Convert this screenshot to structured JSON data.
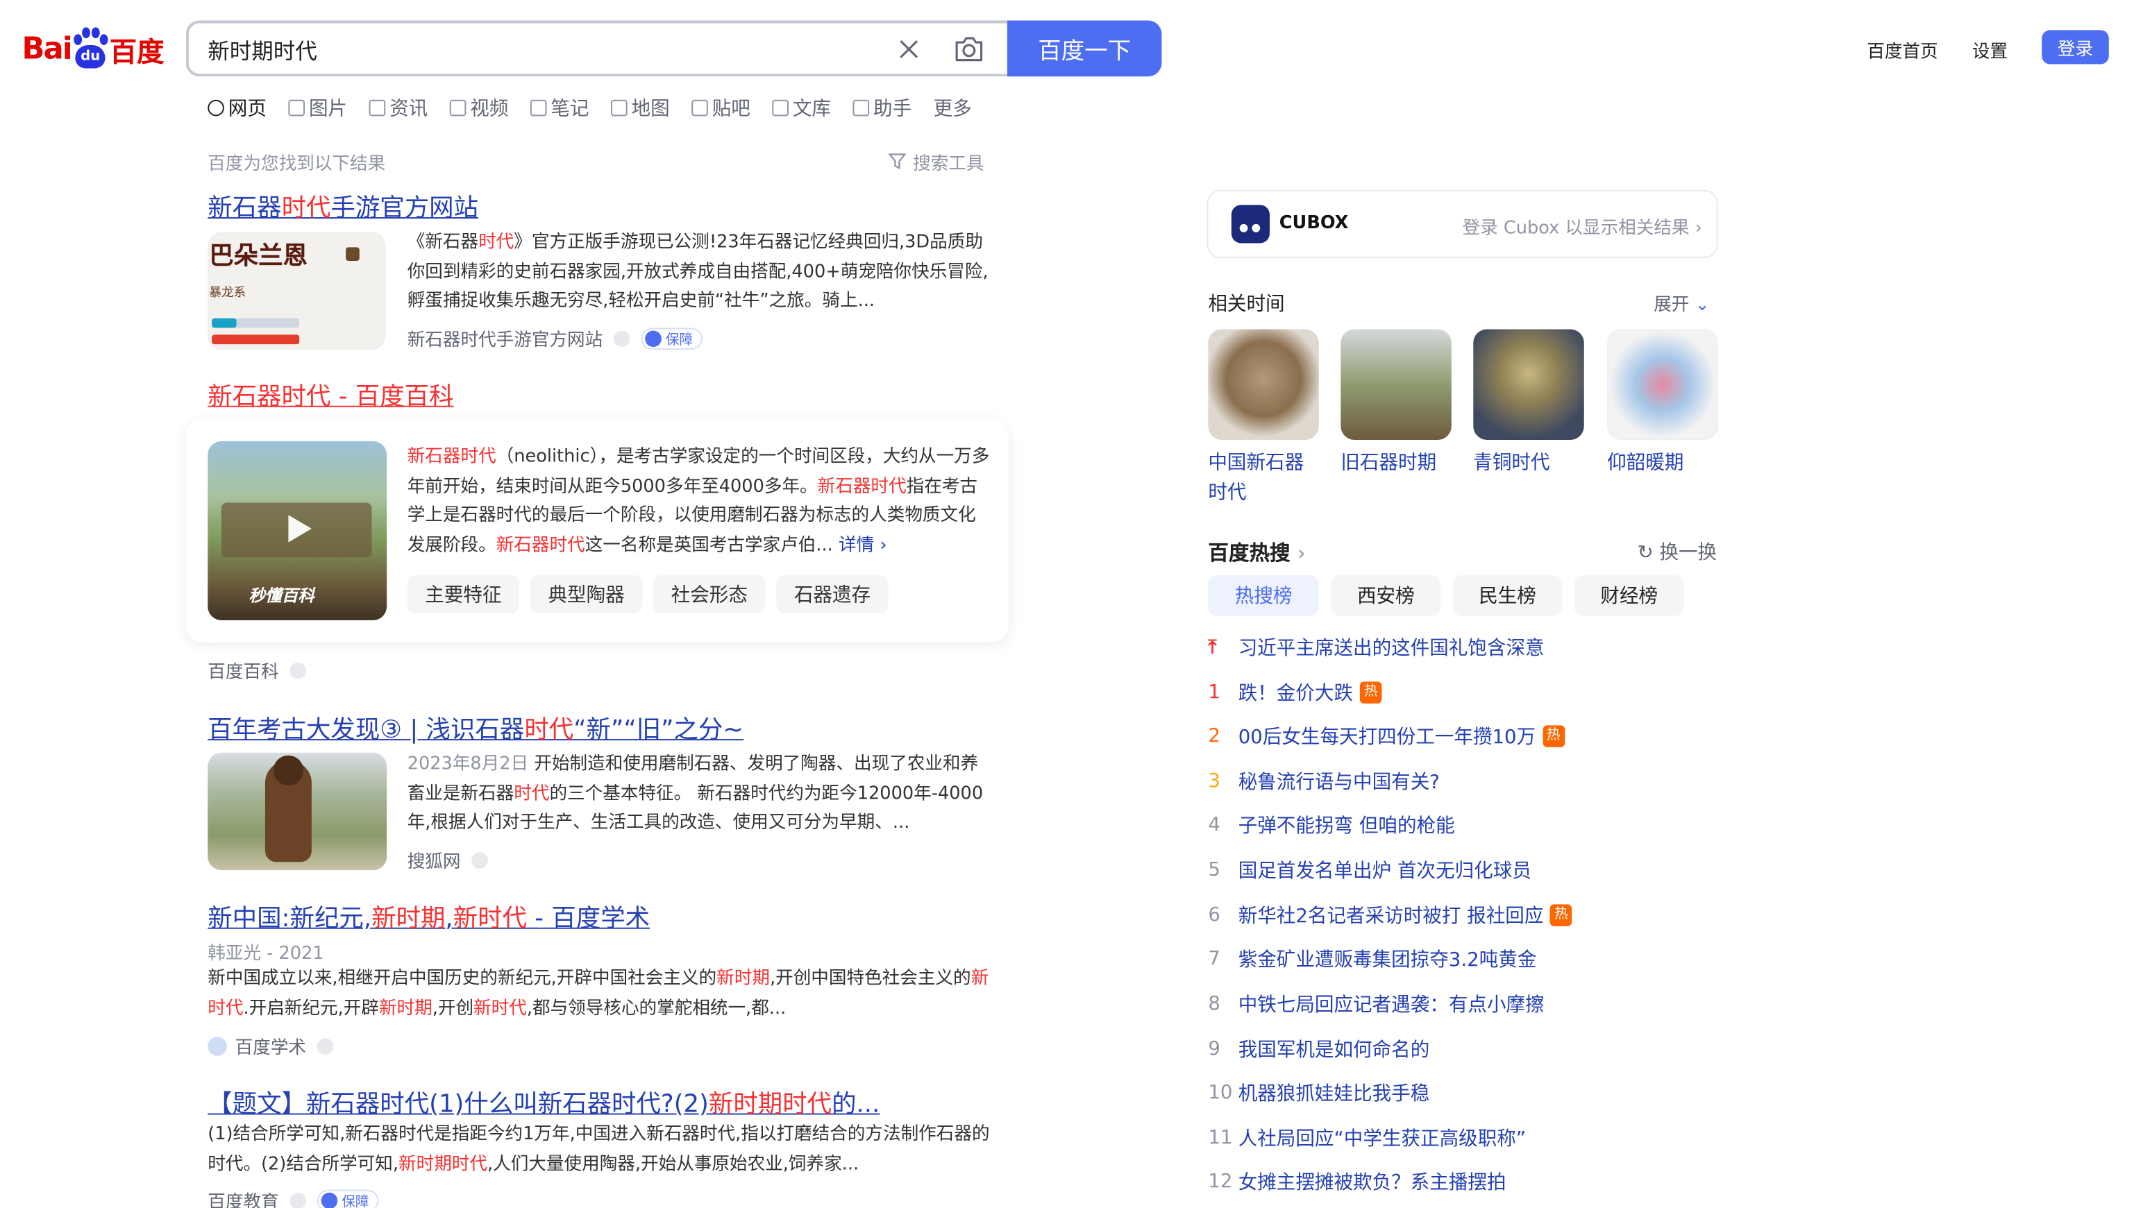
{
  "logo": {
    "left": "Bai",
    "paw": "du",
    "right": "百度"
  },
  "search": {
    "value": "新时期时代",
    "button": "百度一下"
  },
  "header_links": {
    "home": "百度首页",
    "settings": "设置",
    "login": "登录"
  },
  "tabs": [
    {
      "label": "网页",
      "active": true
    },
    {
      "label": "图片"
    },
    {
      "label": "资讯"
    },
    {
      "label": "视频"
    },
    {
      "label": "笔记"
    },
    {
      "label": "地图"
    },
    {
      "label": "贴吧"
    },
    {
      "label": "文库"
    },
    {
      "label": "助手"
    },
    {
      "label": "更多"
    }
  ],
  "results_info": "百度为您找到以下结果",
  "search_tools": "搜索工具",
  "results": [
    {
      "title_parts": [
        "新石器",
        "时代",
        "手游官方网站"
      ],
      "thumb_title": "巴朵兰恩",
      "thumb_sub": "暴龙系",
      "snippet_parts": [
        "《新石器",
        "时代",
        "》官方正版手游现已公测!23年石器记忆经典回归,3D品质助你回到精彩的史前石器家园,开放式养成自由搭配,400+萌宠陪你快乐冒险,孵蛋捕捉收集乐趣无穷尽,轻松开启史前“社牛”之旅。骑上..."
      ],
      "source": "新石器时代手游官方网站",
      "badge": "保障"
    },
    {
      "title": "新石器时代 - 百度百科",
      "thumb_caption": "秒懂百科",
      "snippet_parts": [
        "新石器时代",
        "（neolithic），是考古学家设定的一个时间区段，大约从一万多年前开始，结束时间从距今5000多年至4000多年。",
        "新石器时代",
        "指在考古学上是石器时代的最后一个阶段，以使用磨制石器为标志的人类物质文化发展阶段。",
        "新石器时代",
        "这一名称是英国考古学家卢伯..."
      ],
      "more": "详情",
      "chips": [
        "主要特征",
        "典型陶器",
        "社会形态",
        "石器遗存"
      ],
      "source": "百度百科"
    },
    {
      "title_parts": [
        "百年考古大发现③ | 浅识石器",
        "时代",
        "“新”“旧”之分~"
      ],
      "date": "2023年8月2日",
      "snippet_parts": [
        "开始制造和使用磨制石器、发明了陶器、出现了农业和养畜业是新石器",
        "时代",
        "的三个基本特征。 新石器时代约为距今12000年-4000年,根据人们对于生产、生活工具的改造、使用又可分为早期、..."
      ],
      "source": "搜狐网"
    },
    {
      "title_parts": [
        "新中国:新纪元,",
        "新时期",
        ",",
        "新时代",
        " - 百度学术"
      ],
      "author": "韩亚光 - 2021",
      "snippet_parts": [
        "新中国成立以来,相继开启中国历史的新纪元,开辟中国社会主义的",
        "新时期",
        ",开创中国特色社会主义的",
        "新时代",
        ".开启新纪元,开辟",
        "新时期",
        ",开创",
        "新时代",
        ",都与领导核心的掌舵相统一,都..."
      ],
      "source": "百度学术"
    },
    {
      "title_parts": [
        "【题文】新石器时代(1)什么叫新石器时代?(2)",
        "新时期时代",
        "的..."
      ],
      "snippet_parts": [
        "(1)结合所学可知,新石器时代是指距今约1万年,中国进入新石器时代,指以打磨结合的方法制作石器的时代。(2)结合所学可知,",
        "新时期时代",
        ",人们大量使用陶器,开始从事原始农业,饲养家..."
      ],
      "source": "百度教育",
      "badge": "保障"
    }
  ],
  "cubox": {
    "name": "CUBOX",
    "hint": "登录 Cubox 以显示相关结果"
  },
  "related": {
    "title": "相关时间",
    "expand": "展开",
    "items": [
      "中国新石器时代",
      "旧石器时期",
      "青铜时代",
      "仰韶暖期"
    ]
  },
  "hot": {
    "title": "百度热搜",
    "refresh": "换一换",
    "tabs": [
      "热搜榜",
      "西安榜",
      "民生榜",
      "财经榜"
    ],
    "items": [
      {
        "num": "",
        "text": "习近平主席送出的这件国礼饱含深意",
        "hot": false
      },
      {
        "num": "1",
        "text": "跌！金价大跌",
        "hot": true
      },
      {
        "num": "2",
        "text": "00后女生每天打四份工一年攒10万",
        "hot": true
      },
      {
        "num": "3",
        "text": "秘鲁流行语与中国有关?",
        "hot": false
      },
      {
        "num": "4",
        "text": "子弹不能拐弯 但咱的枪能",
        "hot": false
      },
      {
        "num": "5",
        "text": "国足首发名单出炉 首次无归化球员",
        "hot": false
      },
      {
        "num": "6",
        "text": "新华社2名记者采访时被打 报社回应",
        "hot": true
      },
      {
        "num": "7",
        "text": "紫金矿业遭贩毒集团掠夺3.2吨黄金",
        "hot": false
      },
      {
        "num": "8",
        "text": "中铁七局回应记者遇袭：有点小摩擦",
        "hot": false
      },
      {
        "num": "9",
        "text": "我国军机是如何命名的",
        "hot": false
      },
      {
        "num": "10",
        "text": "机器狼抓娃娃比我手稳",
        "hot": false
      },
      {
        "num": "11",
        "text": "人社局回应“中学生获正高级职称”",
        "hot": false
      },
      {
        "num": "12",
        "text": "女摊主摆摊被欺负？系主播摆拍",
        "hot": false
      }
    ],
    "hot_mark": "热"
  },
  "colors": {
    "brand_blue": "#4e6ef2",
    "link": "#2440b3",
    "highlight": "#f73131",
    "logo_red": "#e10602"
  }
}
